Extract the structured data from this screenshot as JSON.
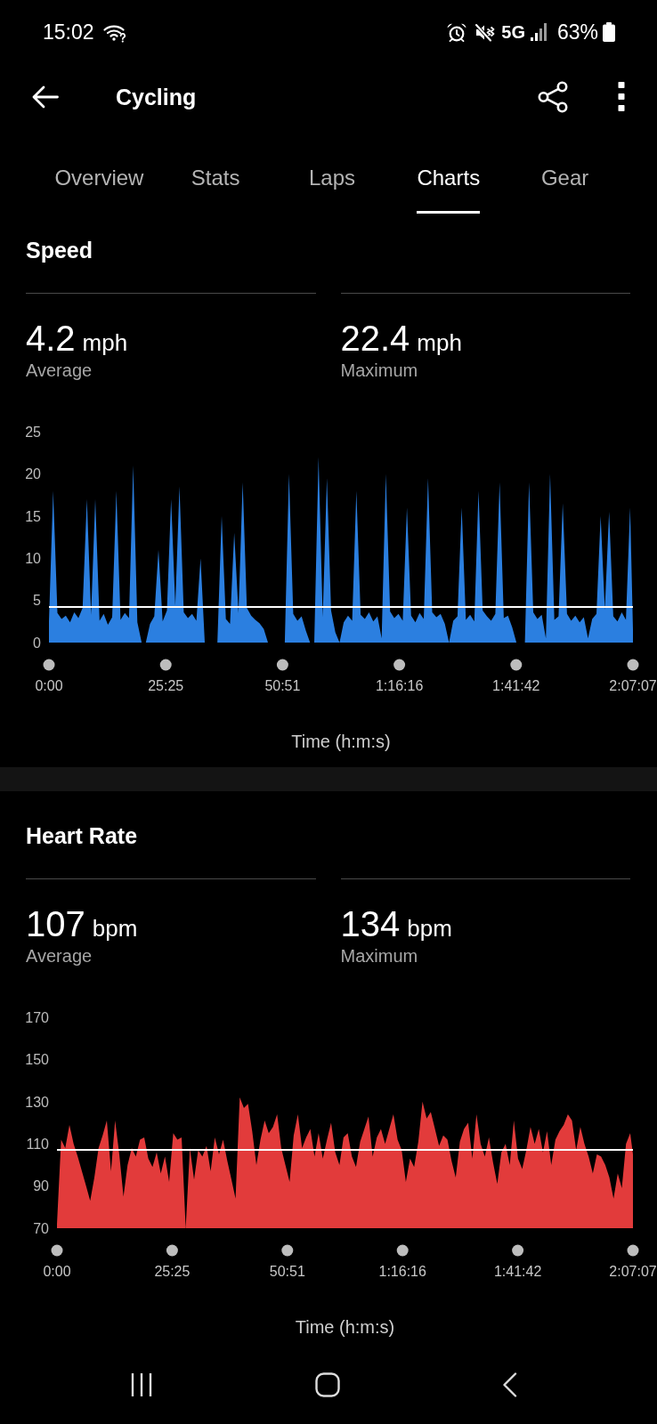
{
  "status_bar": {
    "time": "15:02",
    "network": "5G",
    "battery": "63%"
  },
  "header": {
    "title": "Cycling"
  },
  "tabs": [
    {
      "label": "Overview",
      "selected": false
    },
    {
      "label": "Stats",
      "selected": false
    },
    {
      "label": "Laps",
      "selected": false
    },
    {
      "label": "Charts",
      "selected": true
    },
    {
      "label": "Gear",
      "selected": false
    }
  ],
  "sections": [
    {
      "title": "Speed",
      "stats": [
        {
          "value": "4.2",
          "unit": "mph",
          "label": "Average"
        },
        {
          "value": "22.4",
          "unit": "mph",
          "label": "Maximum"
        }
      ],
      "chart_data": {
        "type": "area",
        "xlabel": "Time (h:m:s)",
        "x": [
          0,
          55,
          110,
          165,
          220,
          275,
          330,
          385,
          440,
          495,
          550,
          605,
          660,
          715,
          770,
          825,
          880,
          935,
          990,
          1045,
          1100,
          1155,
          1210,
          1265,
          1320,
          1375,
          1430,
          1485,
          1540,
          1595,
          1650,
          1705,
          1760,
          1815,
          1870,
          1925,
          1980,
          2035,
          2090,
          2145,
          2200,
          2255,
          2310,
          2365,
          2420,
          2475,
          2530,
          2585,
          2640,
          2695,
          2750,
          2805,
          2860,
          2915,
          2970,
          3025,
          3080,
          3135,
          3190,
          3245,
          3300,
          3355,
          3410,
          3465,
          3520,
          3575,
          3630,
          3685,
          3740,
          3795,
          3850,
          3905,
          3960,
          4015,
          4070,
          4125,
          4180,
          4235,
          4290,
          4345,
          4400,
          4455,
          4510,
          4565,
          4620,
          4675,
          4730,
          4785,
          4840,
          4895,
          4950,
          5005,
          5060,
          5115,
          5170,
          5225,
          5280,
          5335,
          5390,
          5445,
          5500,
          5555,
          5610,
          5665,
          5720,
          5775,
          5830,
          5885,
          5940,
          5995,
          6050,
          6105,
          6160,
          6215,
          6270,
          6325,
          6380,
          6435,
          6490,
          6545,
          6600,
          6655,
          6710,
          6765,
          6820,
          6875,
          6930,
          6985,
          7040,
          7095,
          7150,
          7205,
          7260,
          7315,
          7370,
          7425,
          7480,
          7535,
          7590,
          7627
        ],
        "xlim": [
          0,
          7627
        ],
        "ylim": [
          0,
          25
        ],
        "xticks": [
          {
            "value": 0,
            "label": "0:00"
          },
          {
            "value": 1525,
            "label": "25:25"
          },
          {
            "value": 3051,
            "label": "50:51"
          },
          {
            "value": 4576,
            "label": "1:16:16"
          },
          {
            "value": 6102,
            "label": "1:41:42"
          },
          {
            "value": 7627,
            "label": "2:07:07"
          }
        ],
        "yticks": [
          0,
          5,
          10,
          15,
          20,
          25
        ],
        "series": [
          {
            "color": "#2b7fe0",
            "values": [
              2.5,
              18,
              3.5,
              2.8,
              3.2,
              2.4,
              3.6,
              2.9,
              4.1,
              17,
              3.3,
              17,
              2.6,
              3.4,
              2.1,
              3.0,
              18,
              2.7,
              3.5,
              2.9,
              21,
              2.4,
              0,
              0,
              2.2,
              3.1,
              11,
              2.5,
              3.8,
              17,
              4.4,
              18.5,
              3.6,
              2.9,
              3.4,
              2.6,
              10,
              0,
              0,
              0,
              0,
              15,
              2.8,
              2.2,
              13,
              3.5,
              19,
              4.1,
              3.2,
              2.7,
              2.3,
              1.6,
              0,
              0,
              0,
              0,
              0,
              20,
              3.4,
              2.6,
              3.1,
              1.4,
              0,
              0,
              22,
              3.0,
              19.5,
              3.8,
              1.2,
              0,
              2.4,
              3.2,
              2.6,
              18,
              3.3,
              2.8,
              3.6,
              2.5,
              3.1,
              0.5,
              20,
              3.7,
              2.9,
              3.4,
              2.6,
              16,
              3.2,
              2.4,
              3.5,
              2.8,
              19.5,
              3.6,
              3.0,
              3.4,
              2.2,
              0,
              2.6,
              3.1,
              16,
              2.7,
              3.3,
              2.5,
              18,
              3.8,
              3.1,
              2.6,
              3.4,
              19,
              2.9,
              3.2,
              1.8,
              0,
              0,
              0,
              19,
              3.6,
              2.8,
              3.3,
              0.5,
              20,
              2.7,
              3.1,
              16.5,
              3.4,
              2.6,
              3.2,
              2.4,
              3.0,
              0.5,
              2.8,
              3.4,
              15,
              3.9,
              15.5,
              3.1,
              2.5,
              3.6,
              2.7,
              16,
              1.5
            ]
          }
        ],
        "ref_lines": [
          {
            "axis": "y",
            "value": 4.2
          }
        ]
      }
    },
    {
      "title": "Heart Rate",
      "stats": [
        {
          "value": "107",
          "unit": "bpm",
          "label": "Average"
        },
        {
          "value": "134",
          "unit": "bpm",
          "label": "Maximum"
        }
      ],
      "chart_data": {
        "type": "area",
        "xlabel": "Time (h:m:s)",
        "x": [
          0,
          55,
          110,
          165,
          220,
          275,
          330,
          385,
          440,
          495,
          550,
          605,
          660,
          715,
          770,
          825,
          880,
          935,
          990,
          1045,
          1100,
          1155,
          1210,
          1265,
          1320,
          1375,
          1430,
          1485,
          1540,
          1595,
          1650,
          1705,
          1760,
          1815,
          1870,
          1925,
          1980,
          2035,
          2090,
          2145,
          2200,
          2255,
          2310,
          2365,
          2420,
          2475,
          2530,
          2585,
          2640,
          2695,
          2750,
          2805,
          2860,
          2915,
          2970,
          3025,
          3080,
          3135,
          3190,
          3245,
          3300,
          3355,
          3410,
          3465,
          3520,
          3575,
          3630,
          3685,
          3740,
          3795,
          3850,
          3905,
          3960,
          4015,
          4070,
          4125,
          4180,
          4235,
          4290,
          4345,
          4400,
          4455,
          4510,
          4565,
          4620,
          4675,
          4730,
          4785,
          4840,
          4895,
          4950,
          5005,
          5060,
          5115,
          5170,
          5225,
          5280,
          5335,
          5390,
          5445,
          5500,
          5555,
          5610,
          5665,
          5720,
          5775,
          5830,
          5885,
          5940,
          5995,
          6050,
          6105,
          6160,
          6215,
          6270,
          6325,
          6380,
          6435,
          6490,
          6545,
          6600,
          6655,
          6710,
          6765,
          6820,
          6875,
          6930,
          6985,
          7040,
          7095,
          7150,
          7205,
          7260,
          7315,
          7370,
          7425,
          7480,
          7535,
          7590,
          7627
        ],
        "xlim": [
          0,
          7627
        ],
        "ylim": [
          70,
          170
        ],
        "xticks": [
          {
            "value": 0,
            "label": "0:00"
          },
          {
            "value": 1525,
            "label": "25:25"
          },
          {
            "value": 3051,
            "label": "50:51"
          },
          {
            "value": 4576,
            "label": "1:16:16"
          },
          {
            "value": 6102,
            "label": "1:41:42"
          },
          {
            "value": 7627,
            "label": "2:07:07"
          }
        ],
        "yticks": [
          70,
          90,
          110,
          130,
          150,
          170
        ],
        "series": [
          {
            "color": "#e23b3b",
            "values": [
              72,
              112,
              108,
              119,
              110,
              104,
              97,
              90,
              83,
              94,
              108,
              114,
              121,
              97,
              121,
              105,
              85,
              100,
              108,
              104,
              112,
              113,
              103,
              99,
              106,
              96,
              104,
              92,
              115,
              112,
              113,
              70,
              108,
              93,
              107,
              104,
              109,
              97,
              113,
              105,
              112,
              102,
              93,
              84,
              132,
              127,
              129,
              116,
              100,
              112,
              121,
              115,
              118,
              124,
              108,
              100,
              92,
              114,
              124,
              108,
              113,
              117,
              104,
              115,
              103,
              112,
              120,
              106,
              100,
              113,
              115,
              104,
              99,
              111,
              117,
              123,
              104,
              113,
              117,
              110,
              117,
              124,
              112,
              107,
              92,
              103,
              99,
              111,
              130,
              122,
              125,
              117,
              109,
              114,
              112,
              102,
              94,
              111,
              117,
              120,
              103,
              124,
              110,
              104,
              113,
              101,
              91,
              106,
              110,
              100,
              121,
              103,
              98,
              107,
              118,
              110,
              117,
              106,
              116,
              100,
              112,
              116,
              119,
              124,
              121,
              107,
              118,
              110,
              104,
              96,
              105,
              104,
              100,
              94,
              84,
              96,
              89,
              110,
              115,
              105
            ]
          }
        ],
        "ref_lines": [
          {
            "axis": "y",
            "value": 107
          }
        ]
      }
    }
  ]
}
